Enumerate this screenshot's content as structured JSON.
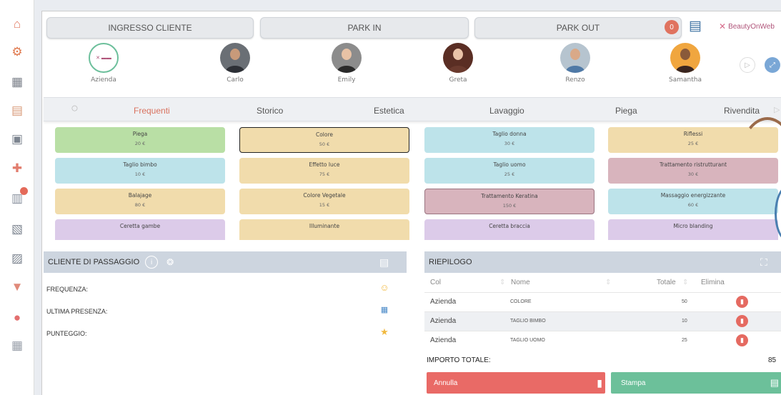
{
  "top_buttons": {
    "ingresso": "INGRESSO CLIENTE",
    "park_in": "PARK IN",
    "park_out": "PARK OUT"
  },
  "notification_count": "0",
  "brand": "BeautyOnWeb",
  "staff": [
    {
      "name": "Azienda",
      "avatar": "logo"
    },
    {
      "name": "Carlo",
      "avatar": "photo"
    },
    {
      "name": "Emily",
      "avatar": "photo"
    },
    {
      "name": "Greta",
      "avatar": "photo"
    },
    {
      "name": "Renzo",
      "avatar": "photo"
    },
    {
      "name": "Samantha",
      "avatar": "photo"
    }
  ],
  "tabs": [
    "Frequenti",
    "Storico",
    "Estetica",
    "Lavaggio",
    "Piega",
    "Rivendita"
  ],
  "services": [
    {
      "name": "Piega",
      "price": "20 €",
      "color": "#b9dfa5"
    },
    {
      "name": "Colore",
      "price": "50 €",
      "color": "#f1dcac"
    },
    {
      "name": "Taglio donna",
      "price": "30 €",
      "color": "#bde3ea"
    },
    {
      "name": "Riflessi",
      "price": "25 €",
      "color": "#f1dcac"
    },
    {
      "name": "Taglio bimbo",
      "price": "10 €",
      "color": "#bde3ea"
    },
    {
      "name": "Effetto luce",
      "price": "75 €",
      "color": "#f1dcac"
    },
    {
      "name": "Taglio uomo",
      "price": "25 €",
      "color": "#bde3ea"
    },
    {
      "name": "Trattamento ristrutturant",
      "price": "30 €",
      "color": "#d8b4bd"
    },
    {
      "name": "Balajage",
      "price": "80 €",
      "color": "#f1dcac"
    },
    {
      "name": "Colore Vegetale",
      "price": "15 €",
      "color": "#f1dcac"
    },
    {
      "name": "Trattamento Keratina",
      "price": "150 €",
      "color": "#d8b4bd"
    },
    {
      "name": "Massaggio energizzante",
      "price": "60 €",
      "color": "#bde3ea"
    },
    {
      "name": "Ceretta gambe",
      "price": "",
      "color": "#dccbe9"
    },
    {
      "name": "Illuminante",
      "price": "",
      "color": "#f1dcac"
    },
    {
      "name": "Ceretta braccia",
      "price": "",
      "color": "#dccbe9"
    },
    {
      "name": "Micro blanding",
      "price": "",
      "color": "#dccbe9"
    }
  ],
  "cliente": {
    "title": "CLIENTE DI PASSAGGIO",
    "rows": [
      "FREQUENZA:",
      "ULTIMA PRESENZA:",
      "PUNTEGGIO:"
    ]
  },
  "riepilogo": {
    "title": "RIEPILOGO",
    "headers": {
      "col": "Col",
      "nome": "Nome",
      "totale": "Totale",
      "elimina": "Elimina"
    },
    "rows": [
      {
        "col": "Azienda",
        "nome": "COLORE",
        "totale": "50"
      },
      {
        "col": "Azienda",
        "nome": "TAGLIO BIMBO",
        "totale": "10"
      },
      {
        "col": "Azienda",
        "nome": "TAGLIO UOMO",
        "totale": "25"
      }
    ],
    "total_label": "IMPORTO TOTALE:",
    "total_value": "85",
    "annulla": "Annulla",
    "stampa": "Stampa"
  }
}
